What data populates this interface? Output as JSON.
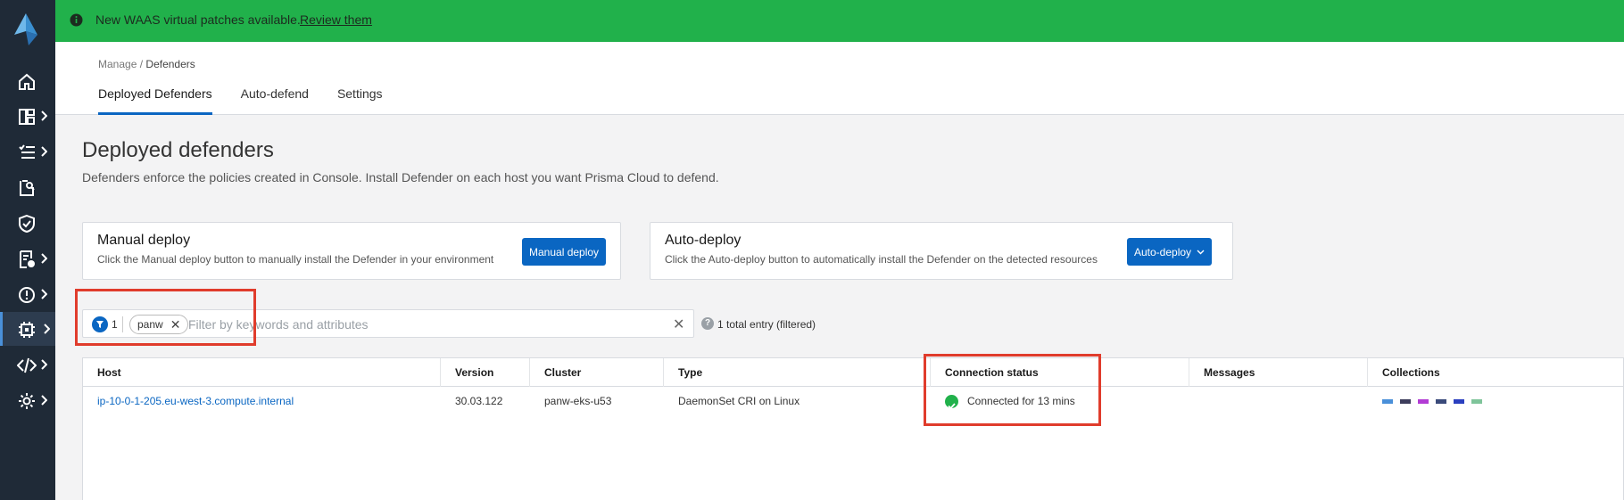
{
  "banner": {
    "text": "New WAAS virtual patches available.",
    "link": "Review them"
  },
  "breadcrumb": {
    "parent": "Manage",
    "separator": "/",
    "current": "Defenders"
  },
  "tabs": [
    {
      "label": "Deployed Defenders",
      "active": true
    },
    {
      "label": "Auto-defend",
      "active": false
    },
    {
      "label": "Settings",
      "active": false
    }
  ],
  "page": {
    "title": "Deployed defenders",
    "description": "Defenders enforce the policies created in Console. Install Defender on each host you want Prisma Cloud to defend."
  },
  "cards": {
    "manual": {
      "title": "Manual deploy",
      "description": "Click the Manual deploy button to manually install the Defender in your environment",
      "button": "Manual deploy"
    },
    "auto": {
      "title": "Auto-deploy",
      "description": "Click the Auto-deploy button to automatically install the Defender on the detected resources",
      "button": "Auto-deploy"
    }
  },
  "filter": {
    "count": "1",
    "chip": "panw",
    "placeholder": "Filter by keywords and attributes",
    "entries": "1 total entry (filtered)"
  },
  "table": {
    "columns": [
      "Host",
      "Version",
      "Cluster",
      "Type",
      "Connection status",
      "Messages",
      "Collections"
    ],
    "rows": [
      {
        "host": "ip-10-0-1-205.eu-west-3.compute.internal",
        "version": "30.03.122",
        "cluster": "panw-eks-u53",
        "type": "DaemonSet CRI on Linux",
        "status": "Connected for 13 mins",
        "messages": "",
        "collection_colors": [
          "#4a90d9",
          "#3d3d5c",
          "#b23cd4",
          "#3a4a7a",
          "#2a3fbf",
          "#7fc49a"
        ]
      }
    ]
  },
  "colors": {
    "accent": "#0a66c2",
    "banner": "#21b14b",
    "sidebar": "#1f2a37",
    "status_ok": "#21b14b",
    "annotation": "#e03c2c"
  },
  "nav_icons": [
    "home-icon",
    "dashboard-icon",
    "list-icon",
    "search-report-icon",
    "shield-icon",
    "compliance-icon",
    "alert-icon",
    "defender-chip-icon",
    "code-icon",
    "gear-icon"
  ]
}
